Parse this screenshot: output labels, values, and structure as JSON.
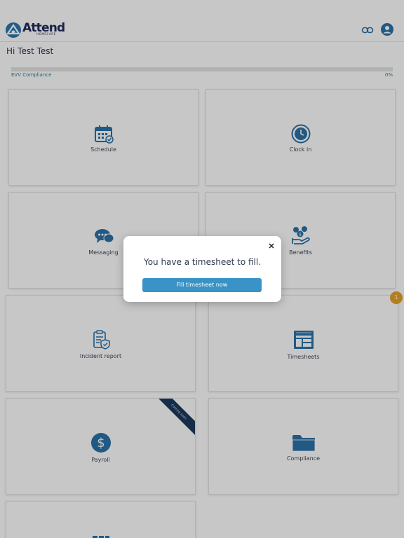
{
  "header": {
    "logo_text": "Attend",
    "logo_subtext": "HOMECARE",
    "link_icon": "link-icon",
    "profile_icon": "user-avatar-icon"
  },
  "greeting": "Hi Test Test",
  "compliance": {
    "label": "EVV Compliance",
    "value": "0%",
    "progress": 0
  },
  "tiles": [
    {
      "label": "Schedule",
      "icon": "calendar-check-icon"
    },
    {
      "label": "Clock in",
      "icon": "clock-icon"
    },
    {
      "label": "Messaging",
      "icon": "chat-bubbles-icon"
    },
    {
      "label": "Benefits",
      "icon": "benefits-hand-icon"
    },
    {
      "label": "Incident report",
      "icon": "clipboard-shield-icon"
    },
    {
      "label": "Timesheets",
      "icon": "timesheet-icon"
    },
    {
      "label": "Payroll",
      "icon": "dollar-icon"
    },
    {
      "label": "Compliance",
      "icon": "folder-icon"
    },
    {
      "label": "",
      "icon": "partial-icon"
    }
  ],
  "ribbon_text": "Coming soon",
  "badge_count": "1",
  "modal": {
    "message": "You have a timesheet to fill.",
    "button_label": "Fill timesheet now",
    "close_icon": "close-icon"
  },
  "colors": {
    "primary": "#3a93c6",
    "brand_dark": "#1f2c5c",
    "icon_blue": "#2b72a8",
    "badge": "#e6a22b",
    "ribbon": "#1d3a5f"
  }
}
